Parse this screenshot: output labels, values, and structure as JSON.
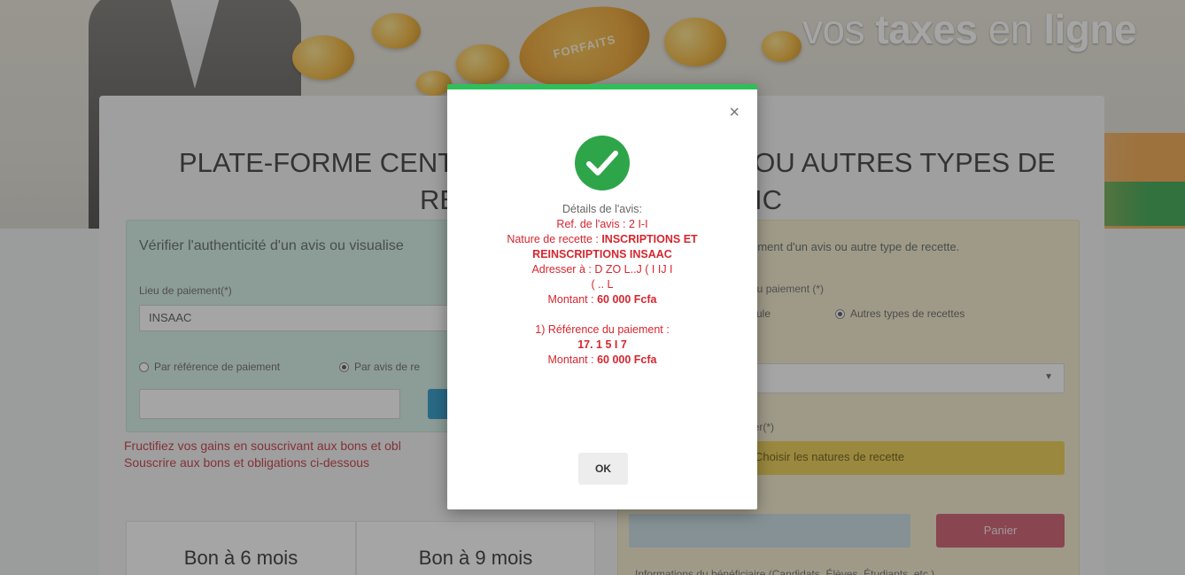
{
  "banner": {
    "slogan_prefix": "vos ",
    "slogan_bold": "taxes",
    "slogan_mid": " en ",
    "slogan_end": "ligne",
    "coin_label": "FORFAITS"
  },
  "page": {
    "title_line1": "PLATE-FORME CENTRA",
    "title_right": "S OU AUTRES TYPES DE",
    "title_line2_left": "RE",
    "title_line2_right": "IC"
  },
  "left_panel": {
    "heading": "Vérifier l'authenticité d'un avis ou visualise",
    "lieu_label": "Lieu de paiement(*)",
    "lieu_value": "INSAAC",
    "radio_ref": "Par référence de paiement",
    "radio_avis": "Par avis de re"
  },
  "promo": {
    "line1": "Fructifiez vos gains en souscrivant aux bons et obl",
    "line2": "Souscrire aux bons et obligations ci-dessous"
  },
  "bonds": [
    {
      "label": "Bon à 6 mois"
    },
    {
      "label": "Bon à 9 mois"
    }
  ],
  "right_panel": {
    "heading": "aiement d'un avis ou autre type de recette.",
    "type_label": "e du paiement (*)",
    "radio_matricule": "tricule",
    "radio_autres": "Autres types de recettes",
    "select_value": "..",
    "payer_label": "ayer(*)",
    "nature_button": "Choisir les natures de recette",
    "panier_button": "Panier",
    "beneficiary": "Informations du bénéficiaire (Candidats, Élèves, Étudiants, etc.)"
  },
  "modal": {
    "close_symbol": "×",
    "details_title": "Détails de l'avis:",
    "ref_label": "Ref. de l'avis : ",
    "ref_value": "2       I-I",
    "nature_label": "Nature de recette : ",
    "nature_value": "INSCRIPTIONS ET REINSCRIPTIONS INSAAC",
    "address_label": "Adresser à : ",
    "address_line1": "D  ZO  L..J  (  I  IJ    I",
    "address_line2": "(   ..  L",
    "amount_label": "Montant : ",
    "amount_value": "60 000 Fcfa",
    "payment_ref_label": "1) Référence du paiement :",
    "payment_ref_value": "17.   1   5   I    7",
    "payment_amount_label": "Montant : ",
    "payment_amount_value": "60 000 Fcfa",
    "ok_button": "OK"
  },
  "colors": {
    "success_green": "#2fa54a",
    "modal_top_bar": "#2fbf5a",
    "detail_red": "#d6262f",
    "panier_red": "#cf5b6d",
    "nature_yellow": "#eccd4e"
  }
}
